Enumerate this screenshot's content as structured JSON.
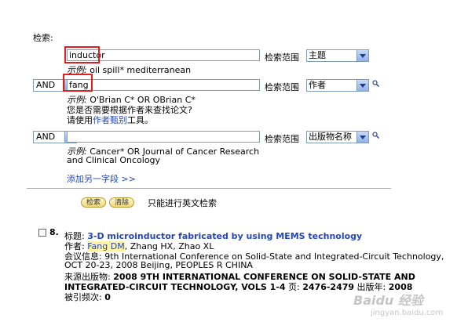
{
  "search": {
    "heading": "检索:",
    "rows": [
      {
        "value": "inductor",
        "example_prefix": "示例:",
        "example_text": "oil spill* mediterranean",
        "field_label": "检索范围",
        "field_select": "主题"
      },
      {
        "operator": "AND",
        "value": "fang",
        "example_prefix": "示例:",
        "example_text": "O'Brian C* OR OBrian C*",
        "hint_line1": "您是否需要根据作者来查找论文?",
        "hint_line2_pre": "请使用",
        "hint_line2_link": "作者甄别",
        "hint_line2_post": "工具。",
        "field_label": "检索范围",
        "field_select": "作者"
      },
      {
        "operator": "AND",
        "value": "",
        "example_prefix": "示例:",
        "example_text_line1": "Cancer* OR Journal of Cancer Research",
        "example_text_line2": "and Clinical Oncology",
        "field_label": "检索范围",
        "field_select": "出版物名称"
      }
    ],
    "add_field": "添加另一字段 >>",
    "search_button": "检索",
    "clear_button": "清除",
    "english_only": "只能进行英文检索"
  },
  "result": {
    "number": "8.",
    "title_label": "标题:",
    "title": "3-D microinductor fabricated by using MEMS technology",
    "author_label": "作者:",
    "author_highlight": "Fang DM",
    "author_rest": ", Zhang HX, Zhao XL",
    "conf_label": "会议信息:",
    "conf_line1": "9th International Conference on Solid-State and Integrated-Circuit Technology,",
    "conf_line2": "OCT 20-23, 2008 Beijing, PEOPLES R CHINA",
    "source_label": "来源出版物:",
    "source_line1": "2008 9TH INTERNATIONAL CONFERENCE ON SOLID-STATE AND",
    "source_line2": "INTEGRATED-CIRCUIT TECHNOLOGY, VOLS 1-4",
    "pages_label": "页:",
    "pages": "2476-2479",
    "year_label": "出版年:",
    "year": "2008",
    "cited_label": "被引频次:",
    "cited": "0"
  },
  "watermark": {
    "text": "Baidu 经验",
    "url": "jingyan.baidu.com"
  },
  "colors": {
    "red_highlight": "#e02020",
    "link": "#2447b8",
    "author_highlight_bg": "#fff2a8"
  }
}
